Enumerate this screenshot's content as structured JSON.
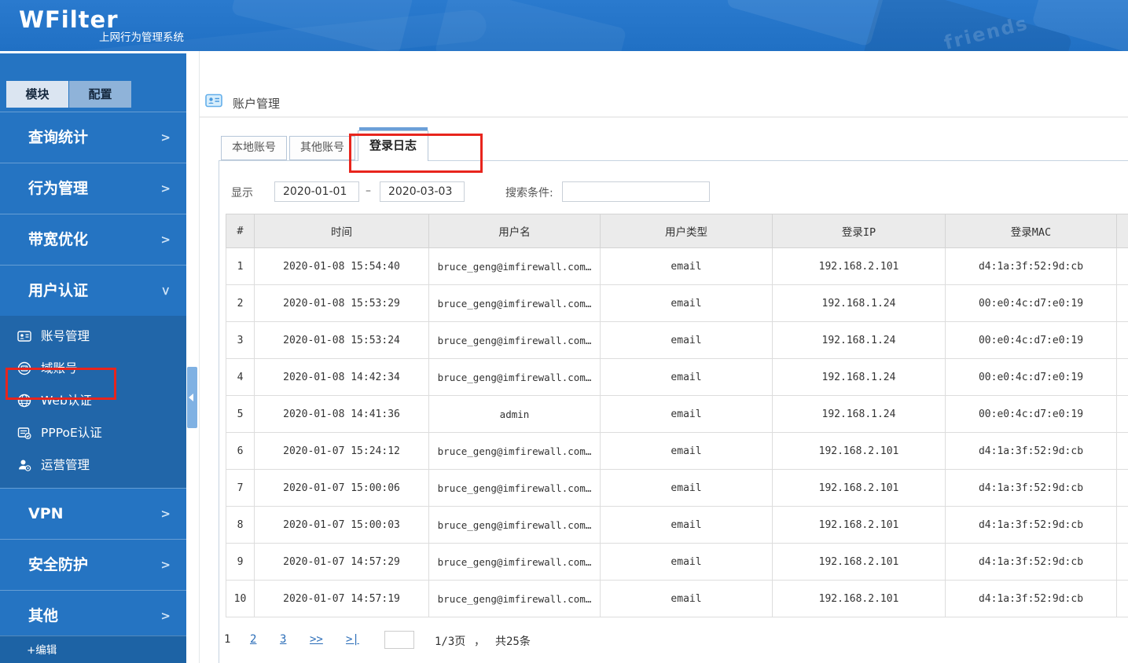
{
  "header": {
    "logo": "WFilter",
    "subtitle": "上网行为管理系统",
    "decor_text": "friends"
  },
  "icons": {
    "chevron_right": ">",
    "chevron_down": ">"
  },
  "sidebar": {
    "tabs": [
      {
        "label": "模块",
        "active": true
      },
      {
        "label": "配置",
        "active": false
      }
    ],
    "items": [
      {
        "label": "查询统计",
        "state": "collapsed"
      },
      {
        "label": "行为管理",
        "state": "collapsed"
      },
      {
        "label": "带宽优化",
        "state": "collapsed"
      },
      {
        "label": "用户认证",
        "state": "expanded"
      }
    ],
    "subitems": [
      {
        "label": "账号管理",
        "icon": "id-card-icon",
        "highlighted": true
      },
      {
        "label": "域账号",
        "icon": "domain-account-icon"
      },
      {
        "label": "Web认证",
        "icon": "globe-icon"
      },
      {
        "label": "PPPoE认证",
        "icon": "pppoe-doc-icon"
      },
      {
        "label": "运营管理",
        "icon": "operations-user-icon"
      }
    ],
    "items_lower": [
      {
        "label": "VPN"
      },
      {
        "label": "安全防护"
      },
      {
        "label": "其他"
      }
    ],
    "edit_label": "+编辑"
  },
  "main": {
    "page_title": "账户管理",
    "tabs": [
      {
        "label": "本地账号",
        "active": false
      },
      {
        "label": "其他账号",
        "active": false
      },
      {
        "label": "登录日志",
        "active": true
      }
    ],
    "filter": {
      "show_label": "显示",
      "date_from": "2020-01-01",
      "range_sep": "–",
      "date_to": "2020-03-03",
      "search_label": "搜索条件:",
      "search_value": ""
    },
    "table": {
      "columns": [
        "#",
        "时间",
        "用户名",
        "用户类型",
        "登录IP",
        "登录MAC",
        ""
      ],
      "rows": [
        [
          "1",
          "2020-01-08 15:54:40",
          "bruce_geng@imfirewall.com…",
          "email",
          "192.168.2.101",
          "d4:1a:3f:52:9d:cb",
          ""
        ],
        [
          "2",
          "2020-01-08 15:53:29",
          "bruce_geng@imfirewall.com…",
          "email",
          "192.168.1.24",
          "00:e0:4c:d7:e0:19",
          ""
        ],
        [
          "3",
          "2020-01-08 15:53:24",
          "bruce_geng@imfirewall.com…",
          "email",
          "192.168.1.24",
          "00:e0:4c:d7:e0:19",
          ""
        ],
        [
          "4",
          "2020-01-08 14:42:34",
          "bruce_geng@imfirewall.com…",
          "email",
          "192.168.1.24",
          "00:e0:4c:d7:e0:19",
          ""
        ],
        [
          "5",
          "2020-01-08 14:41:36",
          "admin",
          "email",
          "192.168.1.24",
          "00:e0:4c:d7:e0:19",
          ""
        ],
        [
          "6",
          "2020-01-07 15:24:12",
          "bruce_geng@imfirewall.com…",
          "email",
          "192.168.2.101",
          "d4:1a:3f:52:9d:cb",
          ""
        ],
        [
          "7",
          "2020-01-07 15:00:06",
          "bruce_geng@imfirewall.com…",
          "email",
          "192.168.2.101",
          "d4:1a:3f:52:9d:cb",
          ""
        ],
        [
          "8",
          "2020-01-07 15:00:03",
          "bruce_geng@imfirewall.com…",
          "email",
          "192.168.2.101",
          "d4:1a:3f:52:9d:cb",
          ""
        ],
        [
          "9",
          "2020-01-07 14:57:29",
          "bruce_geng@imfirewall.com…",
          "email",
          "192.168.2.101",
          "d4:1a:3f:52:9d:cb",
          ""
        ],
        [
          "10",
          "2020-01-07 14:57:19",
          "bruce_geng@imfirewall.com…",
          "email",
          "192.168.2.101",
          "d4:1a:3f:52:9d:cb",
          ""
        ]
      ]
    },
    "pagination": {
      "current": "1",
      "links": [
        "2",
        "3",
        ">>",
        ">|"
      ],
      "jump_value": "",
      "page_info": "1/3页",
      "comma": "，",
      "total_info": "共25条"
    }
  },
  "colors": {
    "topbar_blue": "#2273c9",
    "sidebar_blue": "#2574c2",
    "submenu_blue": "#2166a9",
    "editbar_blue": "#1d63a5",
    "tab_active_bar": "#6b9fd8",
    "annotation_red": "#e8251d",
    "link_blue": "#2a6db8",
    "table_header_bg": "#ebebeb"
  }
}
